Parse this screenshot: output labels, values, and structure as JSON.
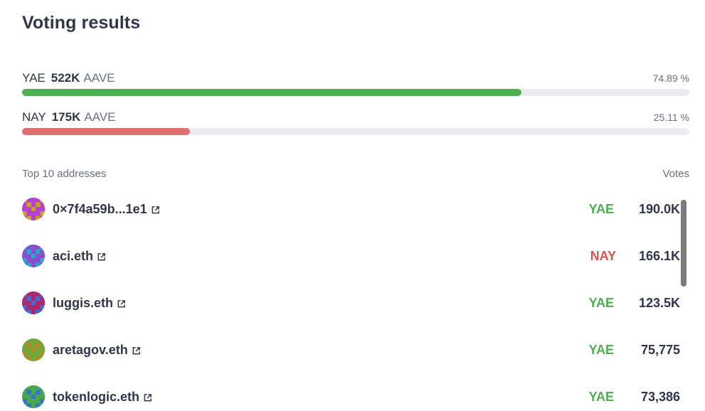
{
  "title": "Voting results",
  "yae": {
    "label": "YAE",
    "amount": "522K",
    "unit": "AAVE",
    "percent_text": "74.89 %",
    "percent": 74.89,
    "color": "#4caf50"
  },
  "nay": {
    "label": "NAY",
    "amount": "175K",
    "unit": "AAVE",
    "percent_text": "25.11 %",
    "percent": 25.11,
    "color": "#e07070"
  },
  "list": {
    "header_left": "Top 10 addresses",
    "header_right": "Votes",
    "rows": [
      {
        "address": "0×7f4a59b...1e1",
        "vote": "YAE",
        "amount": "190.0K",
        "avatar_colors": [
          "#c8a21a",
          "#b63fd6"
        ]
      },
      {
        "address": "aci.eth",
        "vote": "NAY",
        "amount": "166.1K",
        "avatar_colors": [
          "#2aa7c9",
          "#8a4fd0"
        ]
      },
      {
        "address": "luggis.eth",
        "vote": "YAE",
        "amount": "123.5K",
        "avatar_colors": [
          "#3d6fd8",
          "#b0266b"
        ]
      },
      {
        "address": "aretagov.eth",
        "vote": "YAE",
        "amount": "75,775",
        "avatar_colors": [
          "#b58a2c",
          "#6faa3a"
        ]
      },
      {
        "address": "tokenlogic.eth",
        "vote": "YAE",
        "amount": "73,386",
        "avatar_colors": [
          "#2f78c9",
          "#4aa84a"
        ]
      }
    ]
  }
}
